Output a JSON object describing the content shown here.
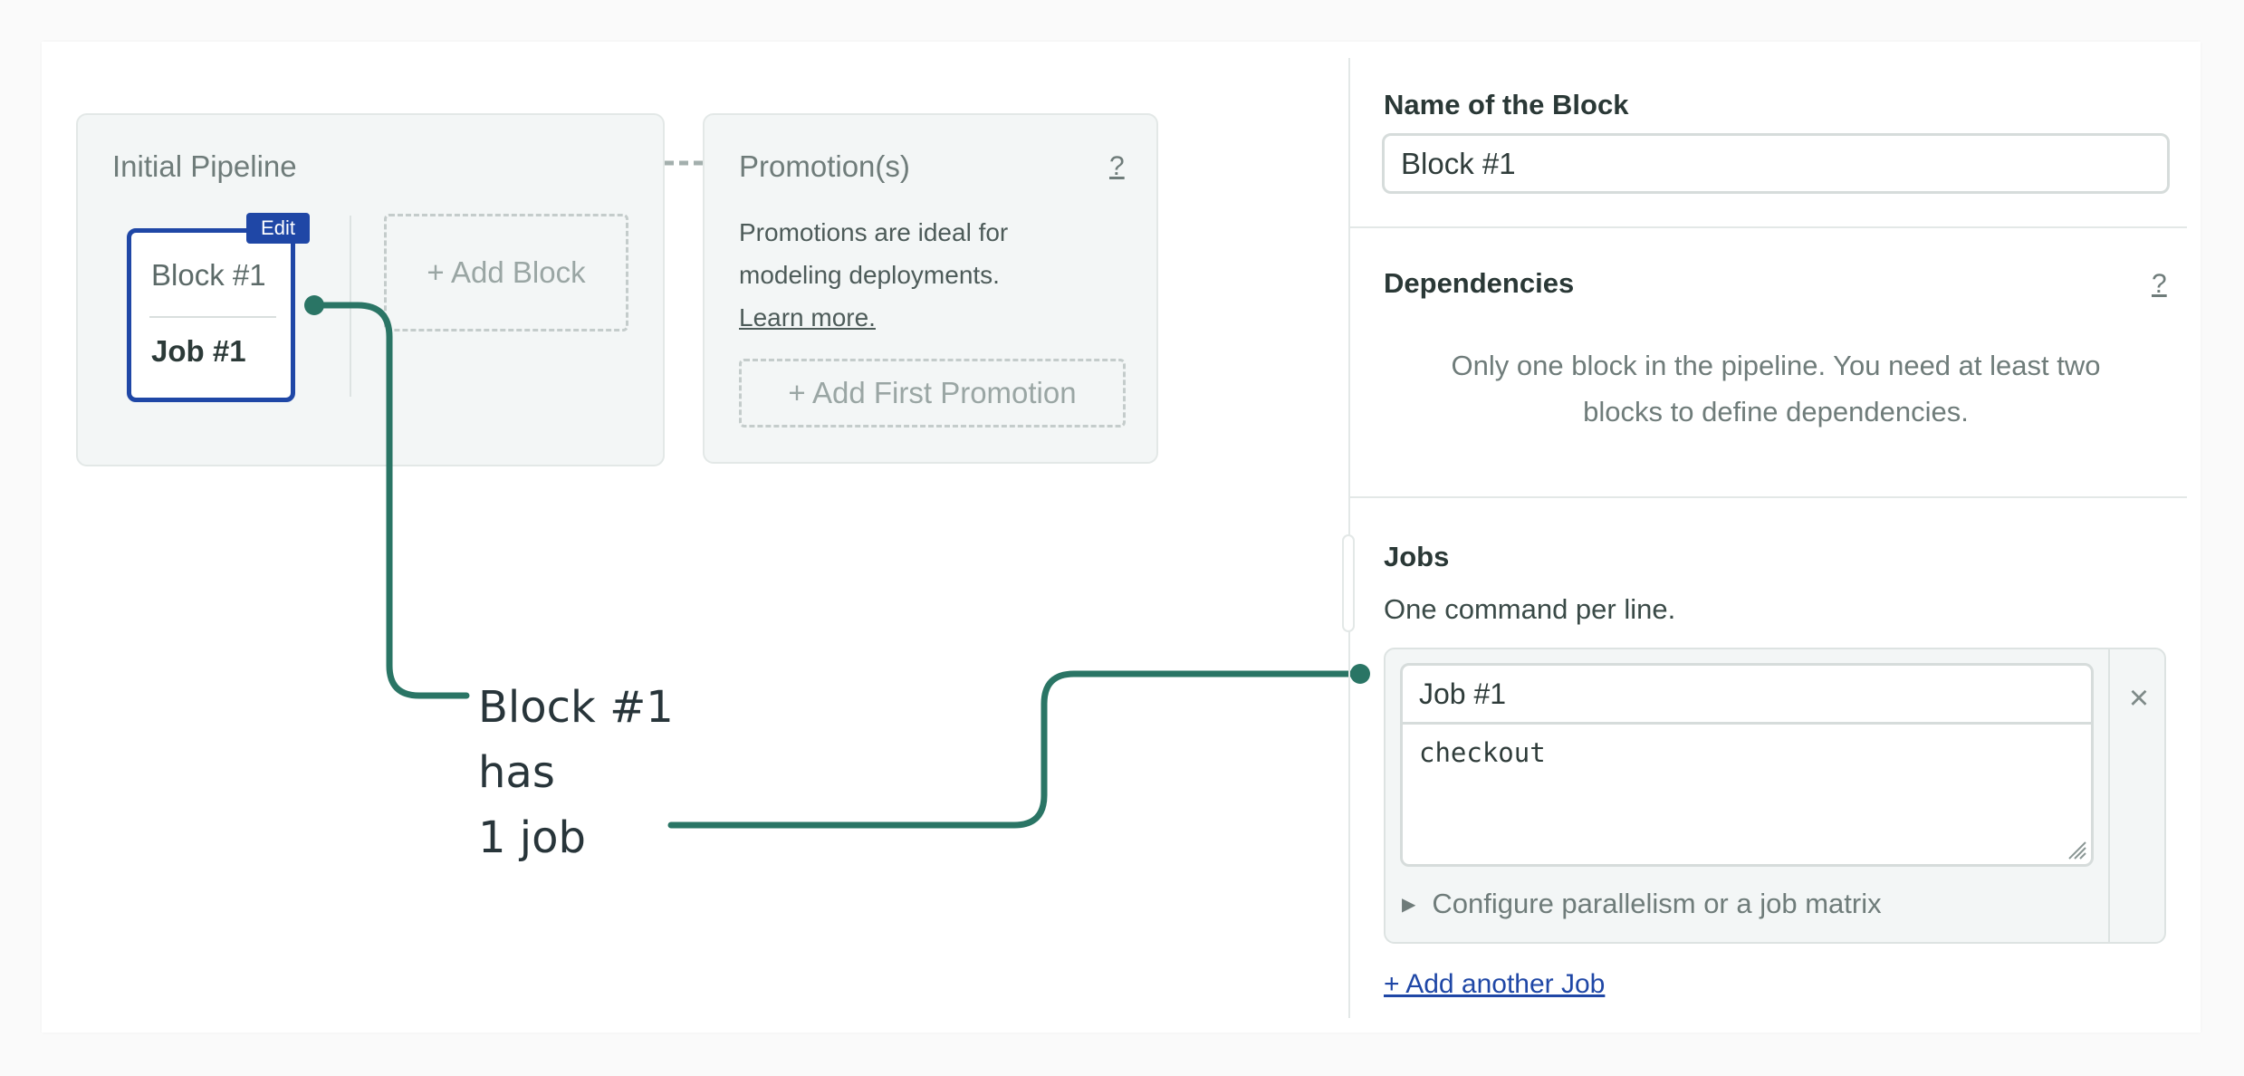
{
  "pipeline": {
    "initial_title": "Initial Pipeline",
    "block": {
      "edit_label": "Edit",
      "name": "Block #1",
      "job": "Job #1"
    },
    "add_block_label": "+ Add Block"
  },
  "promotions": {
    "title": "Promotion(s)",
    "help_label": "?",
    "desc_line1": "Promotions are ideal for",
    "desc_line2": "modeling deployments.",
    "learn_more": "Learn more.",
    "add_first_label": "+ Add First Promotion"
  },
  "annotation": {
    "line1": "Block #1",
    "line2": "has",
    "line3": "1 job"
  },
  "block_settings": {
    "name_heading": "Name of the Block",
    "name_value": "Block #1",
    "dependencies_heading": "Dependencies",
    "dependencies_help": "?",
    "dependencies_line1": "Only one block in the pipeline. You need at least two",
    "dependencies_line2": "blocks to define dependencies.",
    "jobs_heading": "Jobs",
    "jobs_hint": "One command per line.",
    "job_name_value": "Job #1",
    "job_commands": "checkout",
    "remove_label": "×",
    "configure_label": "Configure parallelism or a job matrix",
    "add_job_label": "+ Add another Job"
  },
  "colors": {
    "accent": "#1f47a6",
    "connector": "#2a7565",
    "panel_bg": "#f3f6f6",
    "border": "#e3e8e7"
  }
}
